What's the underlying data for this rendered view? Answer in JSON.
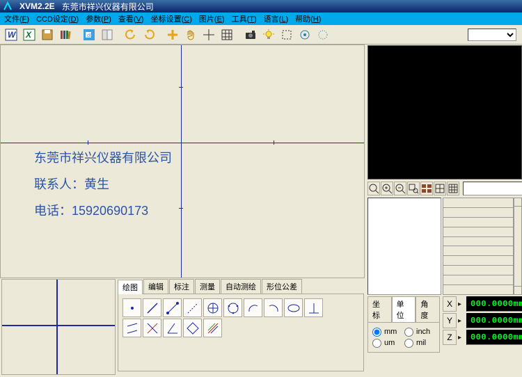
{
  "title": {
    "app": "XVM2.2E",
    "company": "东莞市祥兴仪器有限公司"
  },
  "menu": [
    {
      "label": "文件",
      "key": "F"
    },
    {
      "label": "CCD设定",
      "key": "D"
    },
    {
      "label": "参数",
      "key": "P"
    },
    {
      "label": "查看",
      "key": "V"
    },
    {
      "label": "坐标设置",
      "key": "C"
    },
    {
      "label": "图片",
      "key": "E"
    },
    {
      "label": "工具",
      "key": "T"
    },
    {
      "label": "语言",
      "key": "L"
    },
    {
      "label": "帮助",
      "key": "H"
    }
  ],
  "toolbar_select": {
    "value": ""
  },
  "canvas": {
    "overlay_line1": "东莞市祥兴仪器有限公司",
    "overlay_line2": "联系人：黄生",
    "overlay_line3": "电话：15920690173",
    "crosshair_v_ratio": 0.496,
    "crosshair_h_ratio": 0.418
  },
  "tabs_draw": [
    {
      "key": "draw",
      "label": "绘图",
      "active": true
    },
    {
      "key": "edit",
      "label": "编辑"
    },
    {
      "key": "annot",
      "label": "标注"
    },
    {
      "key": "meas",
      "label": "测量"
    },
    {
      "key": "auto",
      "label": "自动测绘"
    },
    {
      "key": "gdtol",
      "label": "形位公差"
    }
  ],
  "zoom_field": {
    "value": ""
  },
  "unit_tabs": [
    {
      "key": "coord",
      "label": "坐标"
    },
    {
      "key": "unit",
      "label": "单位",
      "active": true
    },
    {
      "key": "angle",
      "label": "角度"
    }
  ],
  "unit_options": {
    "mm": "mm",
    "inch": "inch",
    "um": "um",
    "mil": "mil",
    "selected": "mm"
  },
  "dro": {
    "x_label": "X",
    "y_label": "Y",
    "z_label": "Z",
    "x": "000.0000mm",
    "y": "000.0000mm",
    "z": "000.0000mm"
  }
}
